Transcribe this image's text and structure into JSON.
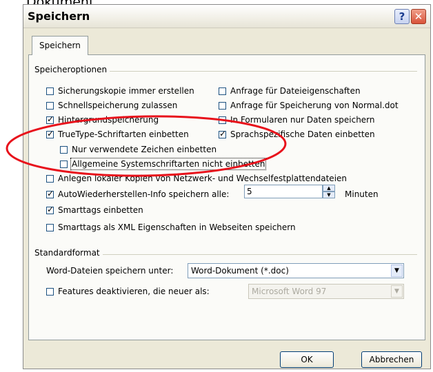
{
  "background_text": "Dokument.",
  "dialog": {
    "title": "Speichern",
    "help_label": "?",
    "close_label": "✕",
    "tab": "Speichern",
    "options_group": "Speicheroptionen",
    "options_left": [
      {
        "label": "Sicherungskopie immer erstellen",
        "checked": false
      },
      {
        "label": "Schnellspeicherung zulassen",
        "checked": false
      },
      {
        "label": "Hintergrundspeicherung",
        "checked": true
      },
      {
        "label": "TrueType-Schriftarten einbetten",
        "checked": true
      }
    ],
    "options_right": [
      {
        "label": "Anfrage für Dateieigenschaften",
        "checked": false
      },
      {
        "label": "Anfrage für Speicherung von Normal.dot",
        "checked": false
      },
      {
        "label": "In Formularen nur Daten speichern",
        "checked": false
      },
      {
        "label": "Sprachspezifische Daten einbetten",
        "checked": true
      }
    ],
    "sub_options": [
      {
        "label": "Nur verwendete Zeichen einbetten",
        "checked": false
      },
      {
        "label": "Allgemeine Systemschriftarten nicht einbetten",
        "checked": false
      }
    ],
    "local_copies": {
      "label": "Anlegen lokaler Kopien von Netzwerk- und Wechselfestplattendateien",
      "checked": false
    },
    "autorecover": {
      "label": "AutoWiederherstellen-Info speichern alle:",
      "checked": true,
      "value": "5",
      "unit": "Minuten"
    },
    "smarttags": {
      "label": "Smarttags einbetten",
      "checked": true
    },
    "smarttags_xml": {
      "label": "Smarttags als XML Eigenschaften in Webseiten speichern",
      "checked": false
    },
    "format_group": "Standardformat",
    "save_as_label": "Word-Dateien speichern unter:",
    "save_as_value": "Word-Dokument (*.doc)",
    "disable_features": {
      "label": "Features deaktivieren, die neuer als:",
      "checked": false
    },
    "disable_features_value": "Microsoft Word 97",
    "ok": "OK",
    "cancel": "Abbrechen"
  },
  "colors": {
    "annotation": "#e8111b",
    "check": "#21a121"
  }
}
